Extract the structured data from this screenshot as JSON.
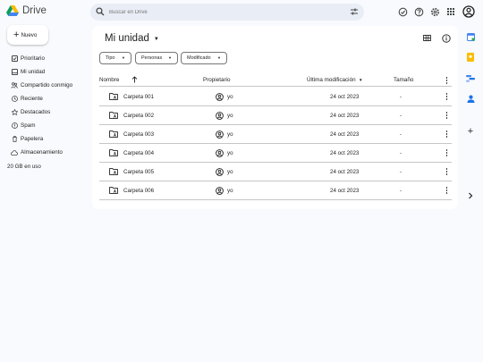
{
  "app": {
    "name": "Drive"
  },
  "search": {
    "placeholder": "Buscar en Drive"
  },
  "new_button": {
    "label": "Nuevo"
  },
  "sidebar": {
    "items": [
      {
        "label": "Prioritario",
        "icon": "checkbox-icon"
      },
      {
        "label": "Mi unidad",
        "icon": "my-drive-icon"
      },
      {
        "label": "Compartido conmigo",
        "icon": "people-icon"
      },
      {
        "label": "Reciente",
        "icon": "clock-icon"
      },
      {
        "label": "Destacados",
        "icon": "star-icon"
      },
      {
        "label": "Spam",
        "icon": "spam-icon"
      },
      {
        "label": "Papelera",
        "icon": "trash-icon"
      },
      {
        "label": "Almacenamiento",
        "icon": "cloud-icon"
      }
    ],
    "storage_text": "20 GB en uso"
  },
  "main": {
    "title": "Mi unidad",
    "filters": [
      "Tipo",
      "Personas",
      "Modificado"
    ],
    "columns": {
      "name": "Nombre",
      "owner": "Propietario",
      "modified": "Última modificación",
      "size": "Tamaño"
    },
    "rows": [
      {
        "name": "Carpeta 001",
        "owner": "yo",
        "modified": "24 oct 2023",
        "size": "-"
      },
      {
        "name": "Carpeta 002",
        "owner": "yo",
        "modified": "24 oct 2023",
        "size": "-"
      },
      {
        "name": "Carpeta 003",
        "owner": "yo",
        "modified": "24 oct 2023",
        "size": "-"
      },
      {
        "name": "Carpeta 004",
        "owner": "yo",
        "modified": "24 oct 2023",
        "size": "-"
      },
      {
        "name": "Carpeta 005",
        "owner": "yo",
        "modified": "24 oct 2023",
        "size": "-"
      },
      {
        "name": "Carpeta 006",
        "owner": "yo",
        "modified": "24 oct 2023",
        "size": "-"
      }
    ]
  },
  "colors": {
    "accent": "#0b57d0",
    "background": "#f8fafd",
    "search_bg": "#e9eef6",
    "divider": "#c4c7c5"
  }
}
